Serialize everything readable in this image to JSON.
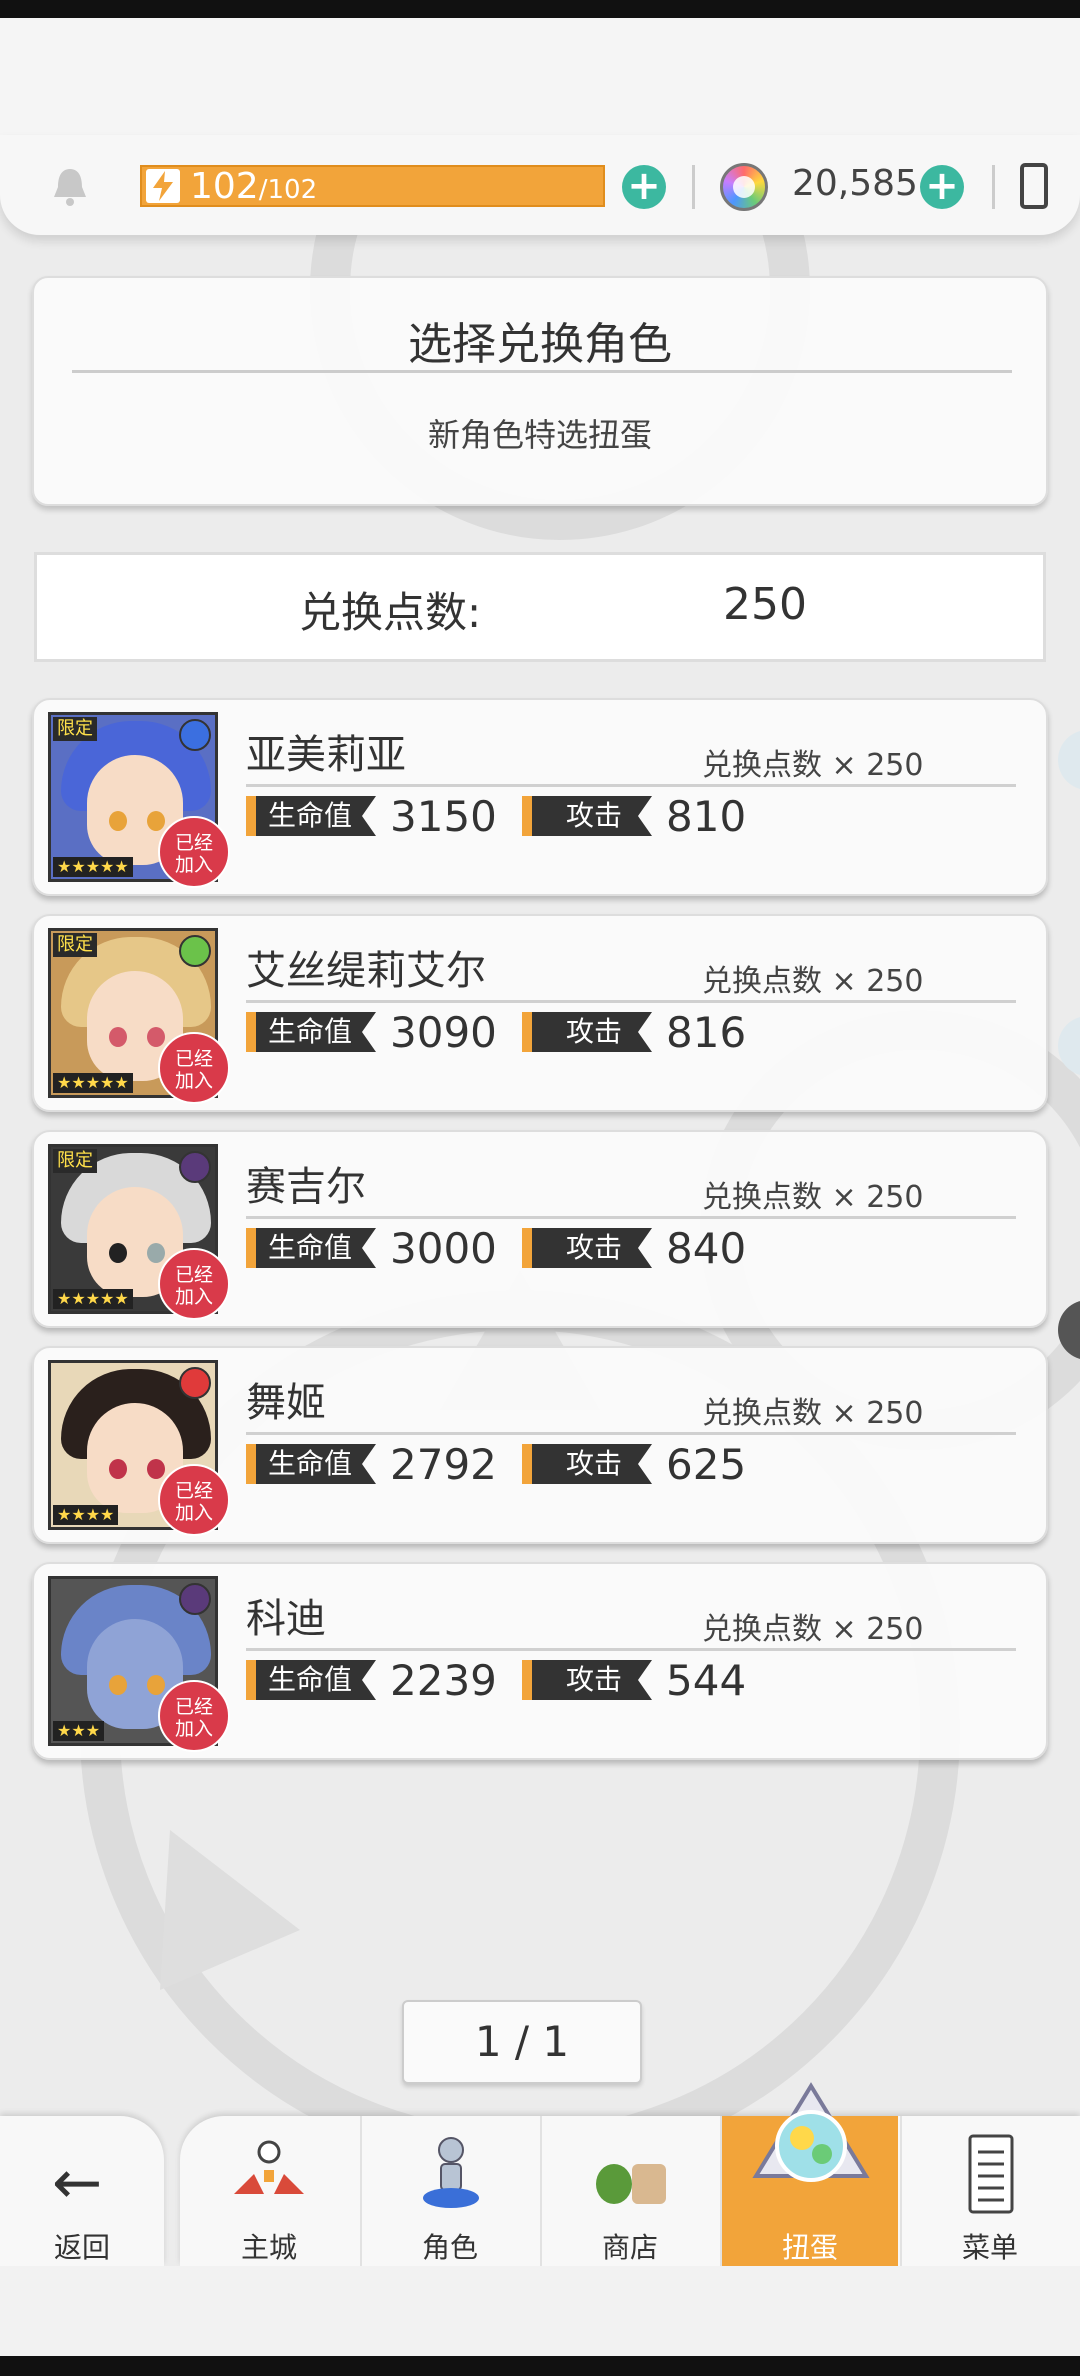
{
  "resources": {
    "stamina_current": "102",
    "stamina_max": "/102",
    "gems": "20,585"
  },
  "header": {
    "title": "选择兑换角色",
    "subtitle": "新角色特选扭蛋"
  },
  "points": {
    "label": "兑换点数:",
    "value": "250"
  },
  "labels": {
    "hp": "生命值",
    "atk": "攻击",
    "joined_line1": "已经",
    "joined_line2": "加入",
    "limited": "限定"
  },
  "characters": [
    {
      "name": "亚美莉亚",
      "cost": "兑换点数 × 250",
      "hp": "3150",
      "atk": "810",
      "stars": "★★★★★",
      "limited": true
    },
    {
      "name": "艾丝缇莉艾尔",
      "cost": "兑换点数 × 250",
      "hp": "3090",
      "atk": "816",
      "stars": "★★★★★",
      "limited": true
    },
    {
      "name": "赛吉尔",
      "cost": "兑换点数 × 250",
      "hp": "3000",
      "atk": "840",
      "stars": "★★★★★",
      "limited": true
    },
    {
      "name": "舞姬",
      "cost": "兑换点数 × 250",
      "hp": "2792",
      "atk": "625",
      "stars": "★★★★",
      "limited": false
    },
    {
      "name": "科迪",
      "cost": "兑换点数 × 250",
      "hp": "2239",
      "atk": "544",
      "stars": "★★★",
      "limited": false
    }
  ],
  "pager": "1 / 1",
  "nav": {
    "back": "返回",
    "tabs": [
      "主城",
      "角色",
      "商店",
      "扭蛋",
      "菜单"
    ],
    "active": "扭蛋"
  },
  "colors": {
    "accent_orange": "#f2a43a",
    "plus_green": "#3cb8a0",
    "joined_red": "#d93a4a"
  }
}
